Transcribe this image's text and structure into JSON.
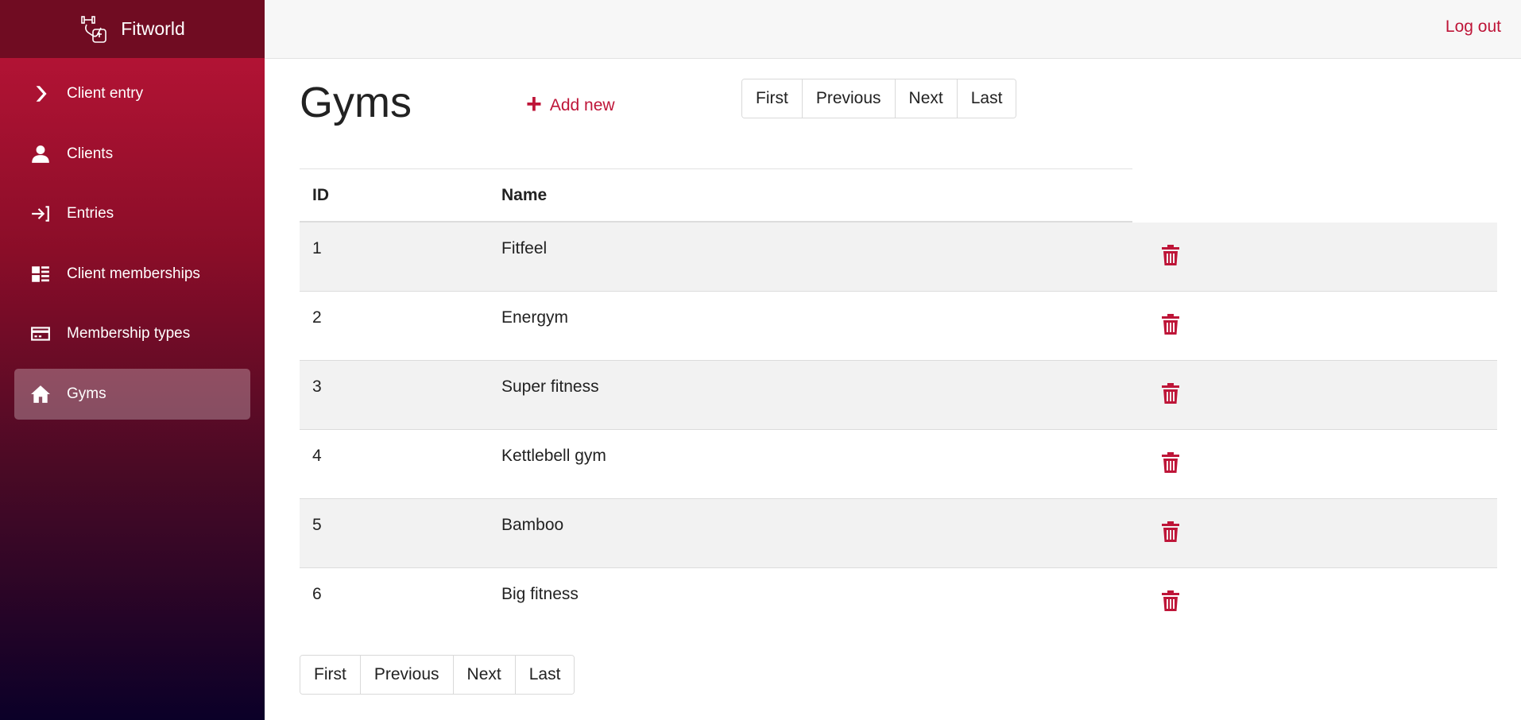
{
  "app": {
    "name": "Fitworld"
  },
  "topbar": {
    "logout_label": "Log out"
  },
  "sidebar": {
    "items": [
      {
        "label": "Client entry",
        "icon": "chevron-right-icon",
        "active": false
      },
      {
        "label": "Clients",
        "icon": "user-icon",
        "active": false
      },
      {
        "label": "Entries",
        "icon": "login-icon",
        "active": false
      },
      {
        "label": "Client memberships",
        "icon": "list-icon",
        "active": false
      },
      {
        "label": "Membership types",
        "icon": "card-icon",
        "active": false
      },
      {
        "label": "Gyms",
        "icon": "home-icon",
        "active": true
      }
    ]
  },
  "main": {
    "title": "Gyms",
    "add_new_label": "Add new",
    "pagination": {
      "first": "First",
      "previous": "Previous",
      "next": "Next",
      "last": "Last"
    },
    "table": {
      "columns": [
        "ID",
        "Name"
      ],
      "rows": [
        {
          "id": "1",
          "name": "Fitfeel"
        },
        {
          "id": "2",
          "name": "Energym"
        },
        {
          "id": "3",
          "name": "Super fitness"
        },
        {
          "id": "4",
          "name": "Kettlebell gym"
        },
        {
          "id": "5",
          "name": "Bamboo"
        },
        {
          "id": "6",
          "name": "Big fitness"
        }
      ]
    }
  },
  "colors": {
    "accent": "#be1538",
    "sidebar_top": "#be1538",
    "sidebar_bottom": "#0b0028",
    "brand_bar": "#700c22"
  }
}
